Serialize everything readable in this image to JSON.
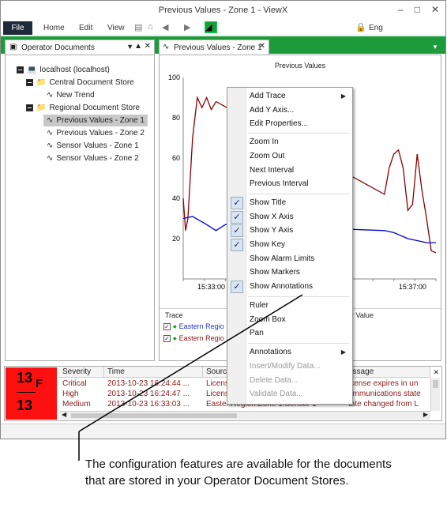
{
  "window": {
    "title": "Previous Values - Zone 1 - ViewX"
  },
  "menu": {
    "file": "File",
    "home": "Home",
    "edit": "Edit",
    "view": "View",
    "lang": "Eng"
  },
  "panel": {
    "title": "Operator Documents"
  },
  "tree": {
    "root": "localhost (localhost)",
    "central": "Central Document Store",
    "new_trend": "New Trend",
    "regional": "Regional Document Store",
    "items": [
      "Previous Values - Zone 1",
      "Previous Values - Zone 2",
      "Sensor Values - Zone 1",
      "Sensor Values - Zone 2"
    ]
  },
  "doc_tab": {
    "label": "Previous Values - Zone 1"
  },
  "chart_data": {
    "type": "line",
    "title": "Previous Values",
    "y_ticks": [
      "100",
      "80",
      "60",
      "40",
      "20"
    ],
    "x_ticks": [
      "15:33:00",
      "15:37:00"
    ],
    "ylim": [
      0,
      100
    ],
    "series": [
      {
        "name": "Eastern Region Zone 1",
        "color": "#8b0000",
        "values": [
          [
            0,
            40
          ],
          [
            1,
            24
          ],
          [
            2,
            30
          ],
          [
            4,
            70
          ],
          [
            6,
            90
          ],
          [
            8,
            85
          ],
          [
            10,
            90
          ],
          [
            12,
            84
          ],
          [
            14,
            88
          ],
          [
            86,
            42
          ],
          [
            88,
            55
          ],
          [
            90,
            62
          ],
          [
            92,
            64
          ],
          [
            94,
            55
          ],
          [
            96,
            34
          ],
          [
            98,
            37
          ],
          [
            100,
            62
          ],
          [
            102,
            44
          ],
          [
            104,
            30
          ],
          [
            106,
            14
          ],
          [
            108,
            13
          ]
        ]
      },
      {
        "name": "Eastern Region",
        "color": "#0000cc",
        "values": [
          [
            0,
            30
          ],
          [
            4,
            31
          ],
          [
            10,
            27
          ],
          [
            14,
            24
          ],
          [
            18,
            27
          ],
          [
            86,
            24
          ],
          [
            90,
            23
          ],
          [
            96,
            20
          ],
          [
            100,
            19
          ],
          [
            104,
            18
          ],
          [
            108,
            18
          ]
        ]
      }
    ]
  },
  "legend": {
    "trace_header": "Trace",
    "value_header": "er Value",
    "rows": [
      "Eastern Regio",
      "Eastern Regio"
    ]
  },
  "alarm": {
    "top": "13",
    "unit": "F",
    "bottom": "13"
  },
  "grid": {
    "headers": [
      "Severity",
      "Time",
      "Sourc",
      "essage"
    ],
    "rows": [
      [
        "Critical",
        "2013-10-23 16:24:44 ...",
        "Licens",
        "icense expires in un"
      ],
      [
        "High",
        "2013-10-23 16:24:47 ...",
        "Licens",
        "ommunications state"
      ],
      [
        "Medium",
        "2013-10-23 16:33:03 ...",
        "Easter.Region.Zone 1.Sensor 1",
        "tate changed from L"
      ]
    ]
  },
  "context_menu": {
    "items": [
      "Add Trace",
      "Add Y Axis...",
      "Edit Properties...",
      "Zoom In",
      "Zoom Out",
      "Next Interval",
      "Previous Interval",
      "Show Title",
      "Show X Axis",
      "Show Y Axis",
      "Show Key",
      "Show Alarm Limits",
      "Show Markers",
      "Show Annotations",
      "Ruler",
      "Zoom Box",
      "Pan",
      "Annotations",
      "Insert/Modify Data...",
      "Delete Data...",
      "Validate Data..."
    ]
  },
  "caption": {
    "line1": "The configuration features are available for the documents",
    "line2": "that are stored in your Operator Document Stores."
  }
}
